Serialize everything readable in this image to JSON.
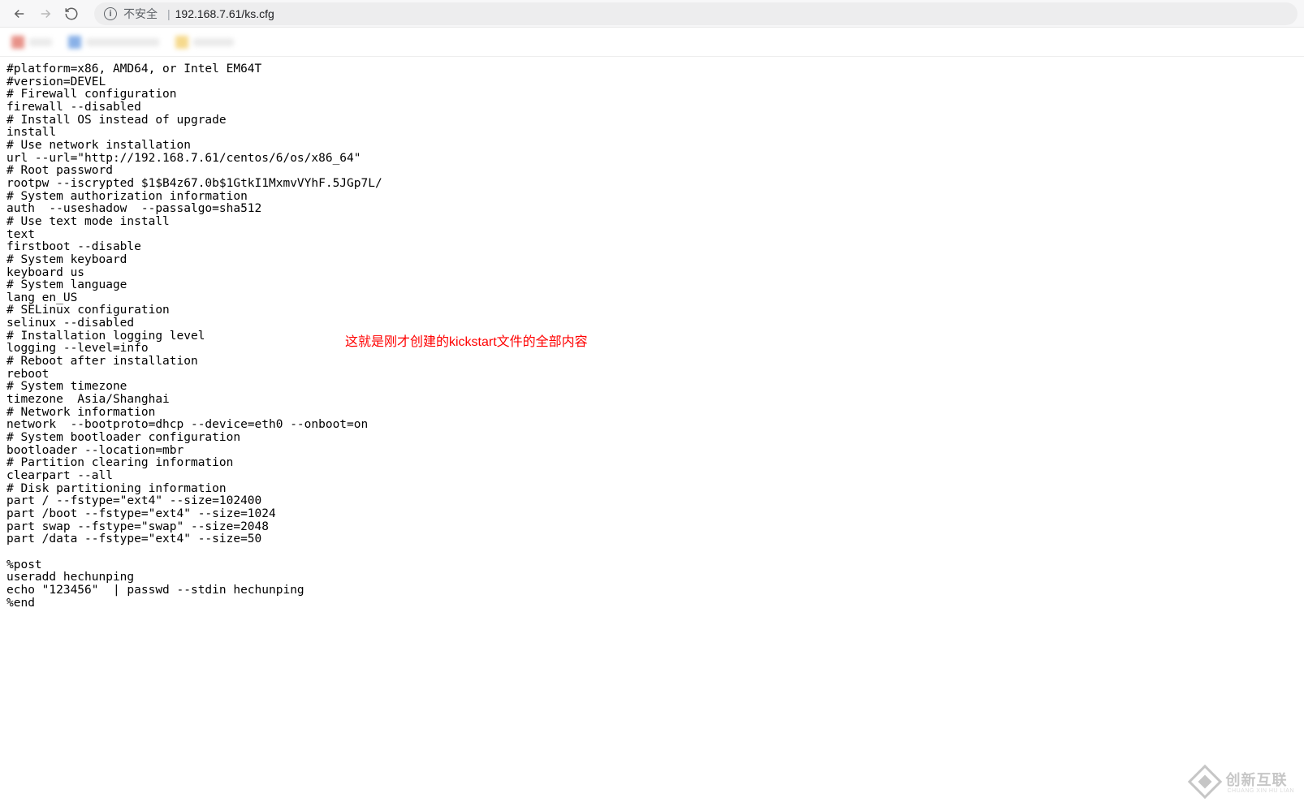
{
  "browser": {
    "security_label": "不安全",
    "url": "192.168.7.61/ks.cfg"
  },
  "file_content": "#platform=x86, AMD64, or Intel EM64T\n#version=DEVEL\n# Firewall configuration\nfirewall --disabled\n# Install OS instead of upgrade\ninstall\n# Use network installation\nurl --url=\"http://192.168.7.61/centos/6/os/x86_64\"\n# Root password\nrootpw --iscrypted $1$B4z67.0b$1GtkI1MxmvVYhF.5JGp7L/\n# System authorization information\nauth  --useshadow  --passalgo=sha512\n# Use text mode install\ntext\nfirstboot --disable\n# System keyboard\nkeyboard us\n# System language\nlang en_US\n# SELinux configuration\nselinux --disabled\n# Installation logging level\nlogging --level=info\n# Reboot after installation\nreboot\n# System timezone\ntimezone  Asia/Shanghai\n# Network information\nnetwork  --bootproto=dhcp --device=eth0 --onboot=on\n# System bootloader configuration\nbootloader --location=mbr\n# Partition clearing information\nclearpart --all\n# Disk partitioning information\npart / --fstype=\"ext4\" --size=102400\npart /boot --fstype=\"ext4\" --size=1024\npart swap --fstype=\"swap\" --size=2048\npart /data --fstype=\"ext4\" --size=50\n\n%post\nuseradd hechunping\necho \"123456\"  | passwd --stdin hechunping\n%end",
  "annotation": "这就是刚才创建的kickstart文件的全部内容",
  "watermark": {
    "text": "创新互联",
    "sub": "CHUANG XIN HU LIAN"
  }
}
